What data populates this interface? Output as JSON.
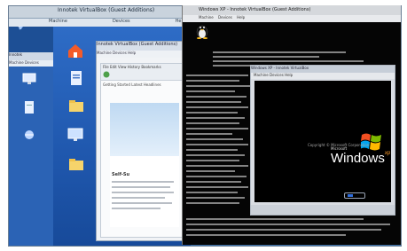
{
  "outer_window": {
    "title": "Innotek VirtualBox (Guest Additions)",
    "menu": [
      "Machine",
      "Devices",
      "Help"
    ]
  },
  "left_window": {
    "title": "Innotek",
    "menu": [
      "Machine",
      "Devices"
    ]
  },
  "inner_window": {
    "title": "Innotek VirtualBox (Guest Additions)",
    "menu": [
      "Machine",
      "Devices",
      "Help"
    ],
    "browser": {
      "menu": [
        "File",
        "Edit",
        "View",
        "History",
        "Bookmarks"
      ],
      "tabs": [
        "Getting Started",
        "Latest Headlines"
      ],
      "heading": "Self-Su"
    }
  },
  "terminal_window": {
    "title": "Windows XP - Innotek VirtualBox (Guest Additions)",
    "menu": [
      "Machine",
      "Devices",
      "Help"
    ]
  },
  "xp_window": {
    "title": "Windows XP - Innotek VirtualBox",
    "menu": [
      "Machine",
      "Devices",
      "Help"
    ],
    "boot": {
      "copyright": "Copyright © Microsoft Corporation",
      "microsoft": "Microsoft",
      "word": "Windows",
      "edition": "xp"
    }
  },
  "colors": {
    "desktop_blue": "#2e6cc6",
    "terminal_bg": "#050505",
    "xp_orange": "#ff9c2a"
  },
  "icons": [
    "vista-logo-icon",
    "home-icon",
    "document-icon",
    "folder-icon",
    "monitor-icon",
    "network-icon",
    "tux-icon",
    "windows-flag-icon"
  ]
}
